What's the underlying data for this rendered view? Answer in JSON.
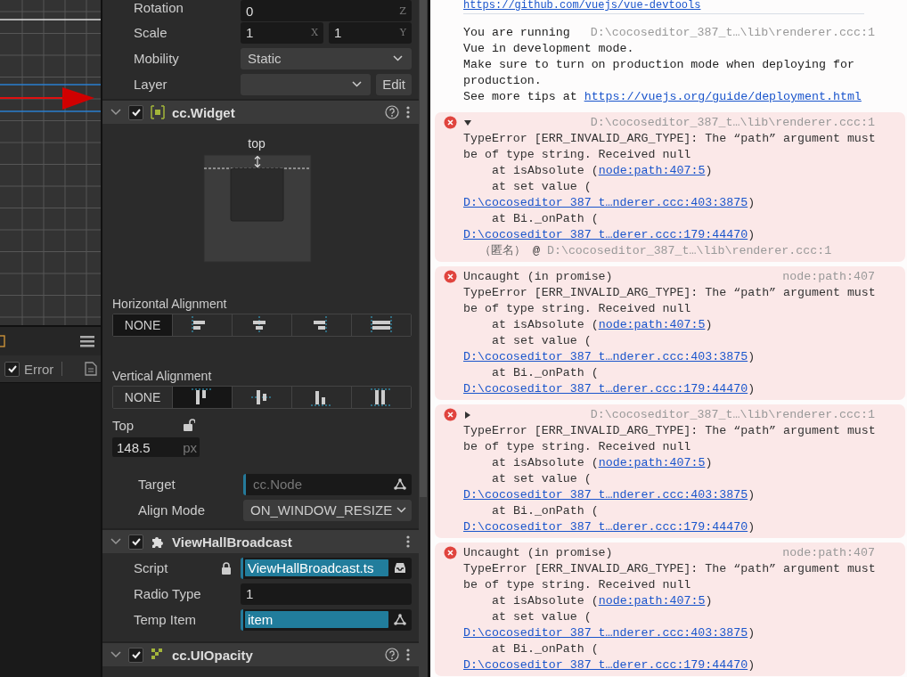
{
  "console_panel": {
    "filters": [
      {
        "label": "Error",
        "checked": true
      }
    ]
  },
  "inspector": {
    "rows": [
      {
        "kind": "vector",
        "label": "Rotation",
        "fields": [
          {
            "value": "0",
            "axis": "Z"
          }
        ]
      },
      {
        "kind": "vector",
        "label": "Scale",
        "fields": [
          {
            "value": "1",
            "axis": "X"
          },
          {
            "value": "1",
            "axis": "Y"
          }
        ]
      },
      {
        "kind": "select",
        "label": "Mobility",
        "value": "Static"
      },
      {
        "kind": "select_edit",
        "label": "Layer",
        "button": "Edit"
      }
    ],
    "widget": {
      "title": "cc.Widget",
      "enabled": true,
      "expanded": true,
      "diagram_label": "top",
      "horizontal_alignment": {
        "label": "Horizontal Alignment",
        "options": [
          {
            "kind": "none",
            "label": "NONE",
            "selected": true
          },
          {
            "kind": "left",
            "selected": false
          },
          {
            "kind": "center",
            "selected": false
          },
          {
            "kind": "right",
            "selected": false
          },
          {
            "kind": "stretch",
            "selected": false
          }
        ]
      },
      "vertical_alignment": {
        "label": "Vertical Alignment",
        "options": [
          {
            "kind": "none",
            "label": "NONE",
            "selected": false
          },
          {
            "kind": "top",
            "selected": true
          },
          {
            "kind": "middle",
            "selected": false
          },
          {
            "kind": "bottom",
            "selected": false
          },
          {
            "kind": "stretch",
            "selected": false
          }
        ]
      },
      "top": {
        "label": "Top",
        "value": "148.5",
        "unit": "px",
        "locked": false
      },
      "target": {
        "label": "Target",
        "placeholder": "cc.Node"
      },
      "align_mode": {
        "label": "Align Mode",
        "value": "ON_WINDOW_RESIZE"
      }
    },
    "script_component": {
      "title": "ViewHallBroadcast",
      "enabled": true,
      "expanded": true,
      "rows": [
        {
          "kind": "asset",
          "label": "Script",
          "locked": true,
          "value": "ViewHallBroadcast.ts"
        },
        {
          "kind": "number",
          "label": "Radio Type",
          "value": "1"
        },
        {
          "kind": "node",
          "label": "Temp Item",
          "value": "item"
        }
      ]
    },
    "next_component": {
      "title": "cc.UIOpacity",
      "enabled": true,
      "expanded": true
    }
  },
  "console": {
    "header_link": "https://github.com/vuejs/vue-devtools",
    "messages": [
      {
        "kind": "log",
        "title": "You are running",
        "source": "D:\\cocoseditor_387_t…\\lib\\renderer.ccc:1",
        "lines": [
          {
            "kind": "text",
            "text": "Vue in development mode."
          },
          {
            "kind": "text",
            "text": "Make sure to turn on production mode when deploying for production."
          },
          {
            "kind": "text",
            "text": "See more tips at ",
            "link": "https://vuejs.org/guide/deployment.html"
          }
        ]
      },
      {
        "kind": "error",
        "expanded": true,
        "source": "D:\\cocoseditor_387_t…\\lib\\renderer.ccc:1",
        "lines": [
          {
            "kind": "text",
            "text": "TypeError [ERR_INVALID_ARG_TYPE]: The “path” argument must be of type string. Received null"
          },
          {
            "kind": "frame",
            "text": "at isAbsolute (",
            "link": "node:path:407:5",
            "tail": ")"
          },
          {
            "kind": "frame",
            "text": "at set value ("
          },
          {
            "kind": "link",
            "link": "D:\\cocoseditor_387_t…nderer.ccc:403:3875",
            "tail": ")"
          },
          {
            "kind": "frame",
            "text": "at Bi._onPath ("
          },
          {
            "kind": "link",
            "link": "D:\\cocoseditor_387_t…derer.ccc:179:44470",
            "tail": ")"
          },
          {
            "kind": "anon",
            "text": "（匿名）",
            "at": "@",
            "source": "D:\\cocoseditor_387_t…\\lib\\renderer.ccc:1"
          }
        ]
      },
      {
        "kind": "error",
        "title": "Uncaught (in promise)",
        "source": "node:path:407",
        "lines": [
          {
            "kind": "text",
            "text": "TypeError [ERR_INVALID_ARG_TYPE]: The “path” argument must be of type string. Received null"
          },
          {
            "kind": "frame",
            "text": "at isAbsolute (",
            "link": "node:path:407:5",
            "tail": ")"
          },
          {
            "kind": "frame",
            "text": "at set value ("
          },
          {
            "kind": "link",
            "link": "D:\\cocoseditor_387_t…nderer.ccc:403:3875",
            "tail": ")"
          },
          {
            "kind": "frame",
            "text": "at Bi._onPath ("
          },
          {
            "kind": "link",
            "link": "D:\\cocoseditor_387_t…derer.ccc:179:44470",
            "tail": ")"
          }
        ]
      },
      {
        "kind": "error",
        "expanded": false,
        "source": "D:\\cocoseditor_387_t…\\lib\\renderer.ccc:1",
        "lines": [
          {
            "kind": "text",
            "text": "TypeError [ERR_INVALID_ARG_TYPE]: The “path” argument must be of type string. Received null"
          },
          {
            "kind": "frame",
            "text": "at isAbsolute (",
            "link": "node:path:407:5",
            "tail": ")"
          },
          {
            "kind": "frame",
            "text": "at set value ("
          },
          {
            "kind": "link",
            "link": "D:\\cocoseditor_387_t…nderer.ccc:403:3875",
            "tail": ")"
          },
          {
            "kind": "frame",
            "text": "at Bi._onPath ("
          },
          {
            "kind": "link",
            "link": "D:\\cocoseditor_387_t…derer.ccc:179:44470",
            "tail": ")"
          }
        ]
      },
      {
        "kind": "error",
        "title": "Uncaught (in promise)",
        "source": "node:path:407",
        "lines": [
          {
            "kind": "text",
            "text": "TypeError [ERR_INVALID_ARG_TYPE]: The “path” argument must be of type string. Received null"
          },
          {
            "kind": "frame",
            "text": "at isAbsolute (",
            "link": "node:path:407:5",
            "tail": ")"
          },
          {
            "kind": "frame",
            "text": "at set value ("
          },
          {
            "kind": "link",
            "link": "D:\\cocoseditor_387_t…nderer.ccc:403:3875",
            "tail": ")"
          },
          {
            "kind": "frame",
            "text": "at Bi._onPath ("
          },
          {
            "kind": "link",
            "link": "D:\\cocoseditor_387_t…derer.ccc:179:44470",
            "tail": ")"
          }
        ]
      }
    ]
  }
}
